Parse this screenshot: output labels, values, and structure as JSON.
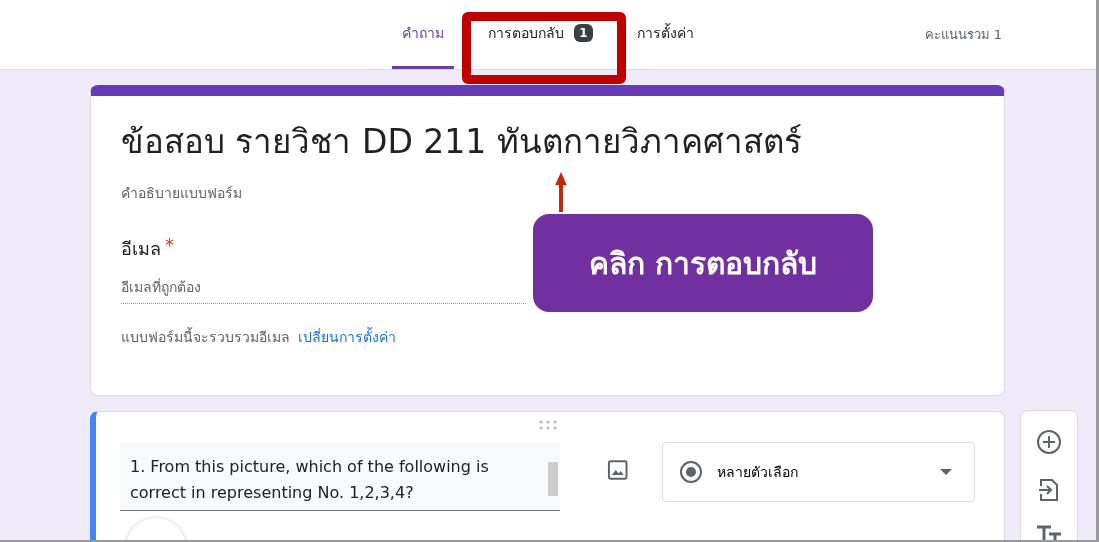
{
  "tabs": [
    {
      "label": "คำถาม",
      "selected": true
    },
    {
      "label": "การตอบกลับ",
      "selected": false,
      "badge": "1",
      "highlighted": true
    },
    {
      "label": "การตั้งค่า",
      "selected": false
    }
  ],
  "total_points": "คะแนนรวม 1",
  "form": {
    "title": "ข้อสอบ รายวิชา DD 211 ทันตกายวิภาคศาสตร์",
    "description": "คำอธิบายแบบฟอร์ม",
    "email_field": {
      "label": "อีเมล",
      "required_mark": "*",
      "placeholder": "อีเมลที่ถูกต้อง"
    },
    "collect_note": "แบบฟอร์มนี้จะรวบรวมอีเมล",
    "settings_link": "เปลี่ยนการตั้งค่า"
  },
  "question": {
    "text": "1. From this picture, which of the following is correct in representing No. 1,2,3,4?",
    "type": "หลายตัวเลือก"
  },
  "callout": {
    "text": "คลิก การตอบกลับ"
  }
}
